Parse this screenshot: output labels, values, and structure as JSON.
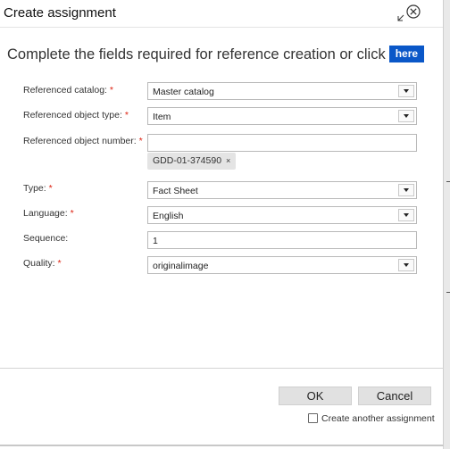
{
  "dialog": {
    "title": "Create assignment"
  },
  "intro": {
    "text": "Complete the fields required for reference creation or click",
    "link_label": "here"
  },
  "fields": {
    "catalog": {
      "label": "Referenced catalog:",
      "required": "*",
      "value": "Master catalog"
    },
    "object_type": {
      "label": "Referenced object type:",
      "required": "*",
      "value": "Item"
    },
    "object_number": {
      "label": "Referenced object number:",
      "required": "*",
      "value": "",
      "tag": "GDD-01-374590",
      "tag_remove": "×"
    },
    "type": {
      "label": "Type:",
      "required": "*",
      "value": "Fact Sheet"
    },
    "language": {
      "label": "Language:",
      "required": "*",
      "value": "English"
    },
    "sequence": {
      "label": "Sequence:",
      "value": "1"
    },
    "quality": {
      "label": "Quality:",
      "required": "*",
      "value": "originalimage"
    }
  },
  "footer": {
    "ok_label": "OK",
    "cancel_label": "Cancel",
    "another_label": "Create another assignment",
    "another_checked": false
  },
  "colors": {
    "link_bg": "#0a57c8",
    "required": "#dd1111",
    "button_bg": "#e1e1e1"
  }
}
